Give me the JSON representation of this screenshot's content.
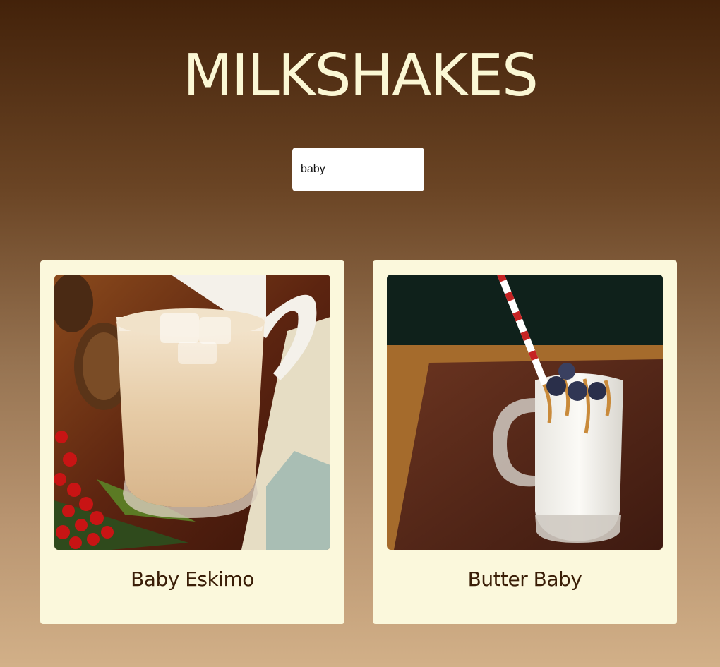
{
  "header": {
    "title": "MILKSHAKES"
  },
  "search": {
    "value": "baby"
  },
  "results": [
    {
      "name": "Baby Eskimo",
      "image": "iced-milk-drink-photo"
    },
    {
      "name": "Butter Baby",
      "image": "blueberry-milkshake-mug-photo"
    }
  ],
  "colors": {
    "title": "#fbf7d4",
    "card_background": "#fbf8dc",
    "card_text": "#3a1e07",
    "gradient_top": "#43220a",
    "gradient_bottom": "#d2b088"
  }
}
